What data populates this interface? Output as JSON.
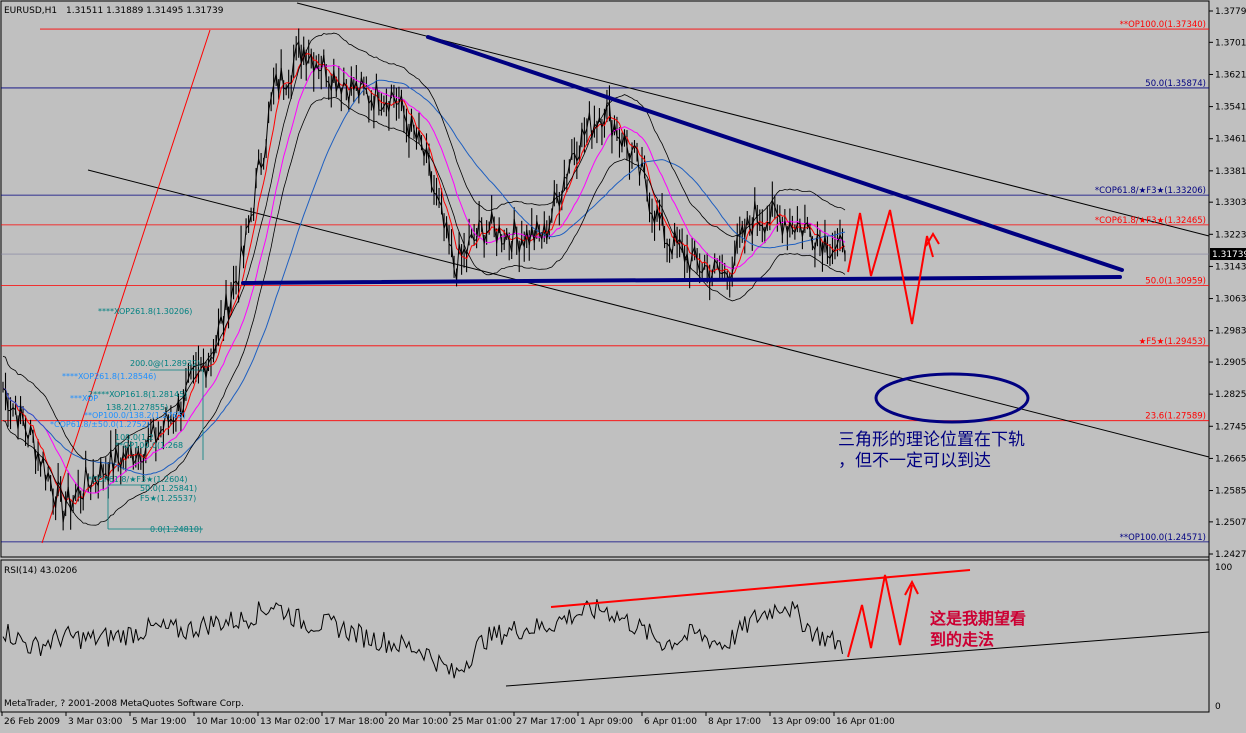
{
  "header": {
    "symbol_label": "EURUSD,H1",
    "ohlc_label": "1.31511 1.31889 1.31495 1.31739"
  },
  "rsi_header": "RSI(14) 43.0206",
  "footer": "MetaTrader, ? 2001-2008 MetaQuotes Software Corp.",
  "colors": {
    "background": "#c0c0c0",
    "price": "#000000",
    "ma_red": "#ff0000",
    "ma_magenta": "#ff00ff",
    "ma_blue": "#1e5fc0",
    "level_red": "#ff0000",
    "level_blue": "#000080",
    "triangle": "#000080",
    "ellipse": "#000080",
    "projection": "#ff0000",
    "teal_text": "#008080",
    "blue_text": "#1e8fff"
  },
  "price_axis": {
    "ticks": [
      "1.37790",
      "1.37010",
      "1.36210",
      "1.35410",
      "1.34610",
      "1.33810",
      "1.33030",
      "1.32230",
      "1.31430",
      "1.30630",
      "1.29830",
      "1.29050",
      "1.28250",
      "1.27450",
      "1.26650",
      "1.25850",
      "1.25070",
      "1.24270"
    ],
    "current": "1.31739"
  },
  "rsi_axis": {
    "ticks": [
      "100",
      "0"
    ]
  },
  "time_axis": {
    "labels": [
      "26 Feb 2009",
      "3 Mar 03:00",
      "5 Mar 19:00",
      "10 Mar 10:00",
      "13 Mar 02:00",
      "17 Mar 18:00",
      "20 Mar 10:00",
      "25 Mar 01:00",
      "27 Mar 17:00",
      "1 Apr 09:00",
      "6 Apr 01:00",
      "8 Apr 17:00",
      "13 Apr 09:00",
      "16 Apr 01:00"
    ]
  },
  "levels": [
    {
      "label": "**OP100.0(1.37340)",
      "color": "red"
    },
    {
      "label": "50.0(1.35874)",
      "color": "blue"
    },
    {
      "label": "*COP61.8/★F3★(1.33206)",
      "color": "blue"
    },
    {
      "label": "*COP61.8/★F3★(1.32465)",
      "color": "red"
    },
    {
      "label": "50.0(1.30959)",
      "color": "red"
    },
    {
      "label": "★F5★(1.29453)",
      "color": "red"
    },
    {
      "label": "23.6(1.27589)",
      "color": "red"
    },
    {
      "label": "**OP100.0(1.24571)",
      "color": "blue"
    }
  ],
  "left_labels": [
    {
      "text": "****XOP261.8(1.30206)",
      "color": "teal"
    },
    {
      "text": "200.0@(1.28932)",
      "color": "teal"
    },
    {
      "text": "****XOP261.8(1.28546)",
      "color": "blue"
    },
    {
      "text": "2****XOP161.8(1.28145)",
      "color": "teal"
    },
    {
      "text": "***XOP",
      "color": "blue"
    },
    {
      "text": "138.2(1.27855)",
      "color": "teal"
    },
    {
      "text": "**OP100.0/138.2(1.2765)",
      "color": "blue"
    },
    {
      "text": "*COP61.8/±50.0(1.2752)",
      "color": "blue"
    },
    {
      "text": "100.0(1.2",
      "color": "teal"
    },
    {
      "text": "**OP100.0(1.268",
      "color": "teal"
    },
    {
      "text": "*COP61.8/★F3★(1.2604)",
      "color": "teal"
    },
    {
      "text": "50.0(1.25841)",
      "color": "teal"
    },
    {
      "text": "F5★(1.25537)",
      "color": "teal"
    },
    {
      "text": "0.0(1.24810)",
      "color": "teal"
    }
  ],
  "annotations": {
    "triangle_note_line1": "三角形的理论位置在下轨",
    "triangle_note_line2": "，但不一定可以到达",
    "rsi_note_line1": "这是我期望看",
    "rsi_note_line2": "到的走法"
  },
  "chart_data": [
    {
      "type": "line",
      "title": "EURUSD,H1",
      "x_categories": [
        "26 Feb 2009",
        "3 Mar 03:00",
        "5 Mar 19:00",
        "10 Mar 10:00",
        "13 Mar 02:00",
        "17 Mar 18:00",
        "20 Mar 10:00",
        "25 Mar 01:00",
        "27 Mar 17:00",
        "1 Apr 09:00",
        "6 Apr 01:00",
        "8 Apr 17:00",
        "13 Apr 09:00",
        "16 Apr 01:00"
      ],
      "ylim": [
        1.2427,
        1.3779
      ],
      "series": [
        {
          "values": [
            1.284,
            1.271,
            1.254,
            1.262,
            1.267,
            1.271,
            1.281,
            1.294,
            1.317,
            1.358,
            1.369,
            1.362,
            1.357,
            1.357,
            1.342,
            1.314,
            1.324,
            1.322,
            1.322,
            1.344,
            1.354,
            1.341,
            1.322,
            1.315,
            1.312,
            1.327,
            1.326,
            1.323,
            1.317
          ]
        }
      ],
      "reference_levels": [
        1.3734,
        1.35874,
        1.33206,
        1.32465,
        1.30959,
        1.29453,
        1.27589,
        1.24571
      ]
    },
    {
      "type": "line",
      "title": "RSI(14) 43.0206",
      "ylim": [
        0,
        100
      ],
      "series": [
        {
          "values": [
            55,
            42,
            50,
            48,
            51,
            56,
            54,
            60,
            62,
            73,
            60,
            58,
            50,
            45,
            40,
            22,
            48,
            55,
            57,
            66,
            70,
            58,
            45,
            52,
            44,
            63,
            74,
            52,
            43
          ]
        }
      ]
    }
  ]
}
